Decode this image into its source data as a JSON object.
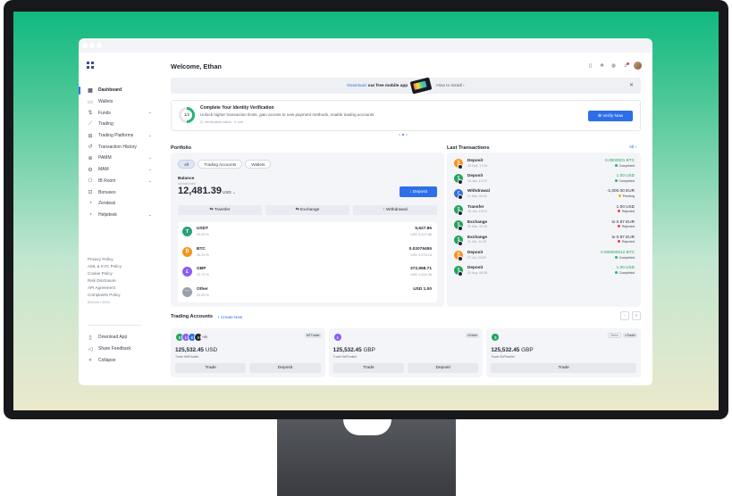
{
  "sidebar": {
    "items": [
      {
        "label": "Dashboard",
        "icon": "grid-icon",
        "glyph": "▦",
        "active": true,
        "expandable": false
      },
      {
        "label": "Wallets",
        "icon": "wallet-icon",
        "glyph": "▭",
        "expandable": false
      },
      {
        "label": "Funds",
        "icon": "transfer-icon",
        "glyph": "⇅",
        "expandable": true
      },
      {
        "label": "Trading",
        "icon": "chart-icon",
        "glyph": "⟋",
        "expandable": false
      },
      {
        "label": "Trading Platforms",
        "icon": "platform-icon",
        "glyph": "⊞",
        "expandable": true
      },
      {
        "label": "Transaction History",
        "icon": "history-icon",
        "glyph": "↺",
        "expandable": false
      },
      {
        "label": "PAMM",
        "icon": "pamm-icon",
        "glyph": "⊕",
        "expandable": true
      },
      {
        "label": "MAM",
        "icon": "mam-icon",
        "glyph": "⚙",
        "expandable": true
      },
      {
        "label": "IB Room",
        "icon": "people-icon",
        "glyph": "⚇",
        "expandable": true
      },
      {
        "label": "Bonuses",
        "icon": "gift-icon",
        "glyph": "⊡",
        "expandable": false
      },
      {
        "label": "Zendesk",
        "icon": "support-icon",
        "glyph": "◔",
        "expandable": false
      },
      {
        "label": "Helpdesk",
        "icon": "headset-icon",
        "glyph": "◔",
        "expandable": true
      }
    ],
    "legal": [
      "Privacy Policy",
      "AML & KYC Policy",
      "Cookie Policy",
      "Risk Disclosure",
      "API Agreement",
      "Complaints Policy"
    ],
    "copyright": "B2Core • 2024",
    "bottom": [
      {
        "label": "Download App",
        "icon": "download-app-icon",
        "glyph": "▯"
      },
      {
        "label": "Share Feedback",
        "icon": "feedback-icon",
        "glyph": "◁"
      },
      {
        "label": "Collapse",
        "icon": "collapse-icon",
        "glyph": "«"
      }
    ]
  },
  "header": {
    "welcome": "Welcome, Ethan"
  },
  "banner": {
    "download": "Download",
    "text": "our free mobile app",
    "how": "How to install ›",
    "close": "✕"
  },
  "verification": {
    "step": "1/2",
    "progress": 0.5,
    "title": "Complete Your Identity Verification",
    "subtitle": "Unlock higher transaction limits, gain access to new payment methods, enable trading accounts",
    "note": "Verification takes ~3 min",
    "button": "Verify Now"
  },
  "portfolio": {
    "title": "Portfolio",
    "tabs": [
      "All",
      "Trading Accounts",
      "Wallets"
    ],
    "balance_label": "Balance",
    "balance_sub": "Account total",
    "balance": "12,481.39",
    "currency": "USD ⌄",
    "deposit": "↓ Deposit",
    "actions": [
      "⇆ Transfer",
      "⇆ Exchange",
      "↑ Withdrawal"
    ],
    "assets": [
      {
        "name": "USDT",
        "pct": "40.09 %",
        "value": "5,627.86",
        "usd": "USD 5,627.86",
        "color": "#26a17b",
        "glyph": "T"
      },
      {
        "name": "BTC",
        "pct": "35.23 %",
        "value": "0.02079455",
        "usd": "USD 2,275.18",
        "color": "#f7931a",
        "glyph": "₿"
      },
      {
        "name": "GBP",
        "pct": "22.73 %",
        "value": "372,958.71",
        "usd": "USD 1,534.38",
        "color": "#8b5cf6",
        "glyph": "£"
      },
      {
        "name": "Other",
        "pct": "20.95 %",
        "value": "USD 1.00",
        "usd": "",
        "color": "#9aa0ab",
        "glyph": "⋯"
      }
    ]
  },
  "transactions": {
    "title": "Last Transactions",
    "all": "All ›",
    "items": [
      {
        "type": "Deposit",
        "date": "22 Dec, 17:00",
        "amount": "0.0000001 BTC",
        "amount_color": "#22a35a",
        "status": "Completed",
        "status_color": "#22b573",
        "icon_color": "#f7931a",
        "glyph": "₿"
      },
      {
        "type": "Deposit",
        "date": "14 Jan, 13:13",
        "amount": "1.00 USD",
        "amount_color": "#22a35a",
        "status": "Completed",
        "status_color": "#22b573",
        "icon_color": "#22a35a",
        "glyph": "$"
      },
      {
        "type": "Withdrawal",
        "date": "01 Mar, 09:41",
        "amount": "-1,000.00 EUR",
        "amount_color": "#1f2430",
        "status": "Pending",
        "status_color": "#f5b400",
        "icon_color": "#2d6fe8",
        "glyph": "€"
      },
      {
        "type": "Transfer",
        "date": "18 Jan, 18:10",
        "amount": "1.00 USD",
        "amount_color": "#1f2430",
        "status": "Rejected",
        "status_color": "#e6424b",
        "icon_color": "#22a35a",
        "glyph": "$"
      },
      {
        "type": "Exchange",
        "date": "30 Mar, 20:10",
        "amount": "to 0.87 EUR",
        "amount_color": "#1f2430",
        "status": "Rejected",
        "status_color": "#e6424b",
        "icon_color": "#22a35a",
        "glyph": "$"
      },
      {
        "type": "Exchange",
        "date": "11 Oct, 11:19",
        "amount": "to 0.87 EUR",
        "amount_color": "#1f2430",
        "status": "Rejected",
        "status_color": "#e6424b",
        "icon_color": "#22a35a",
        "glyph": "$"
      },
      {
        "type": "Deposit",
        "date": "27 Jul, 23:09",
        "amount": "0.000000012 BTC",
        "amount_color": "#22a35a",
        "status": "Completed",
        "status_color": "#22b573",
        "icon_color": "#f7931a",
        "glyph": "₿"
      },
      {
        "type": "Deposit",
        "date": "20 Aug, 08:38",
        "amount": "1.00 USD",
        "amount_color": "#22a35a",
        "status": "Completed",
        "status_color": "#22b573",
        "icon_color": "#22a35a",
        "glyph": "$"
      }
    ]
  },
  "trading_accounts": {
    "title": "Trading Accounts",
    "create": "+ Create New",
    "prev": "‹",
    "next": "›",
    "cards": [
      {
        "amount": "125,532.45",
        "currency": "USD",
        "sub": "Trade 6WFwallet",
        "badge": "MTTrader",
        "badge2": "",
        "more": "+99",
        "buttons": [
          "Trade",
          "Deposit"
        ]
      },
      {
        "amount": "125,532.45",
        "currency": "GBP",
        "sub": "Trade 6WFwallet",
        "badge": "cTrader",
        "badge2": "",
        "more": "",
        "buttons": [
          "Trade",
          "Deposit"
        ]
      },
      {
        "amount": "125,532.45",
        "currency": "GBP",
        "sub": "Trade 6WFwallet",
        "badge": "cTrader",
        "badge2": "Demo",
        "more": "",
        "buttons": [
          "Trade"
        ]
      }
    ]
  },
  "colors": {
    "accent": "#2d6fe8",
    "success": "#22b573",
    "danger": "#e6424b",
    "warning": "#f5b400"
  }
}
